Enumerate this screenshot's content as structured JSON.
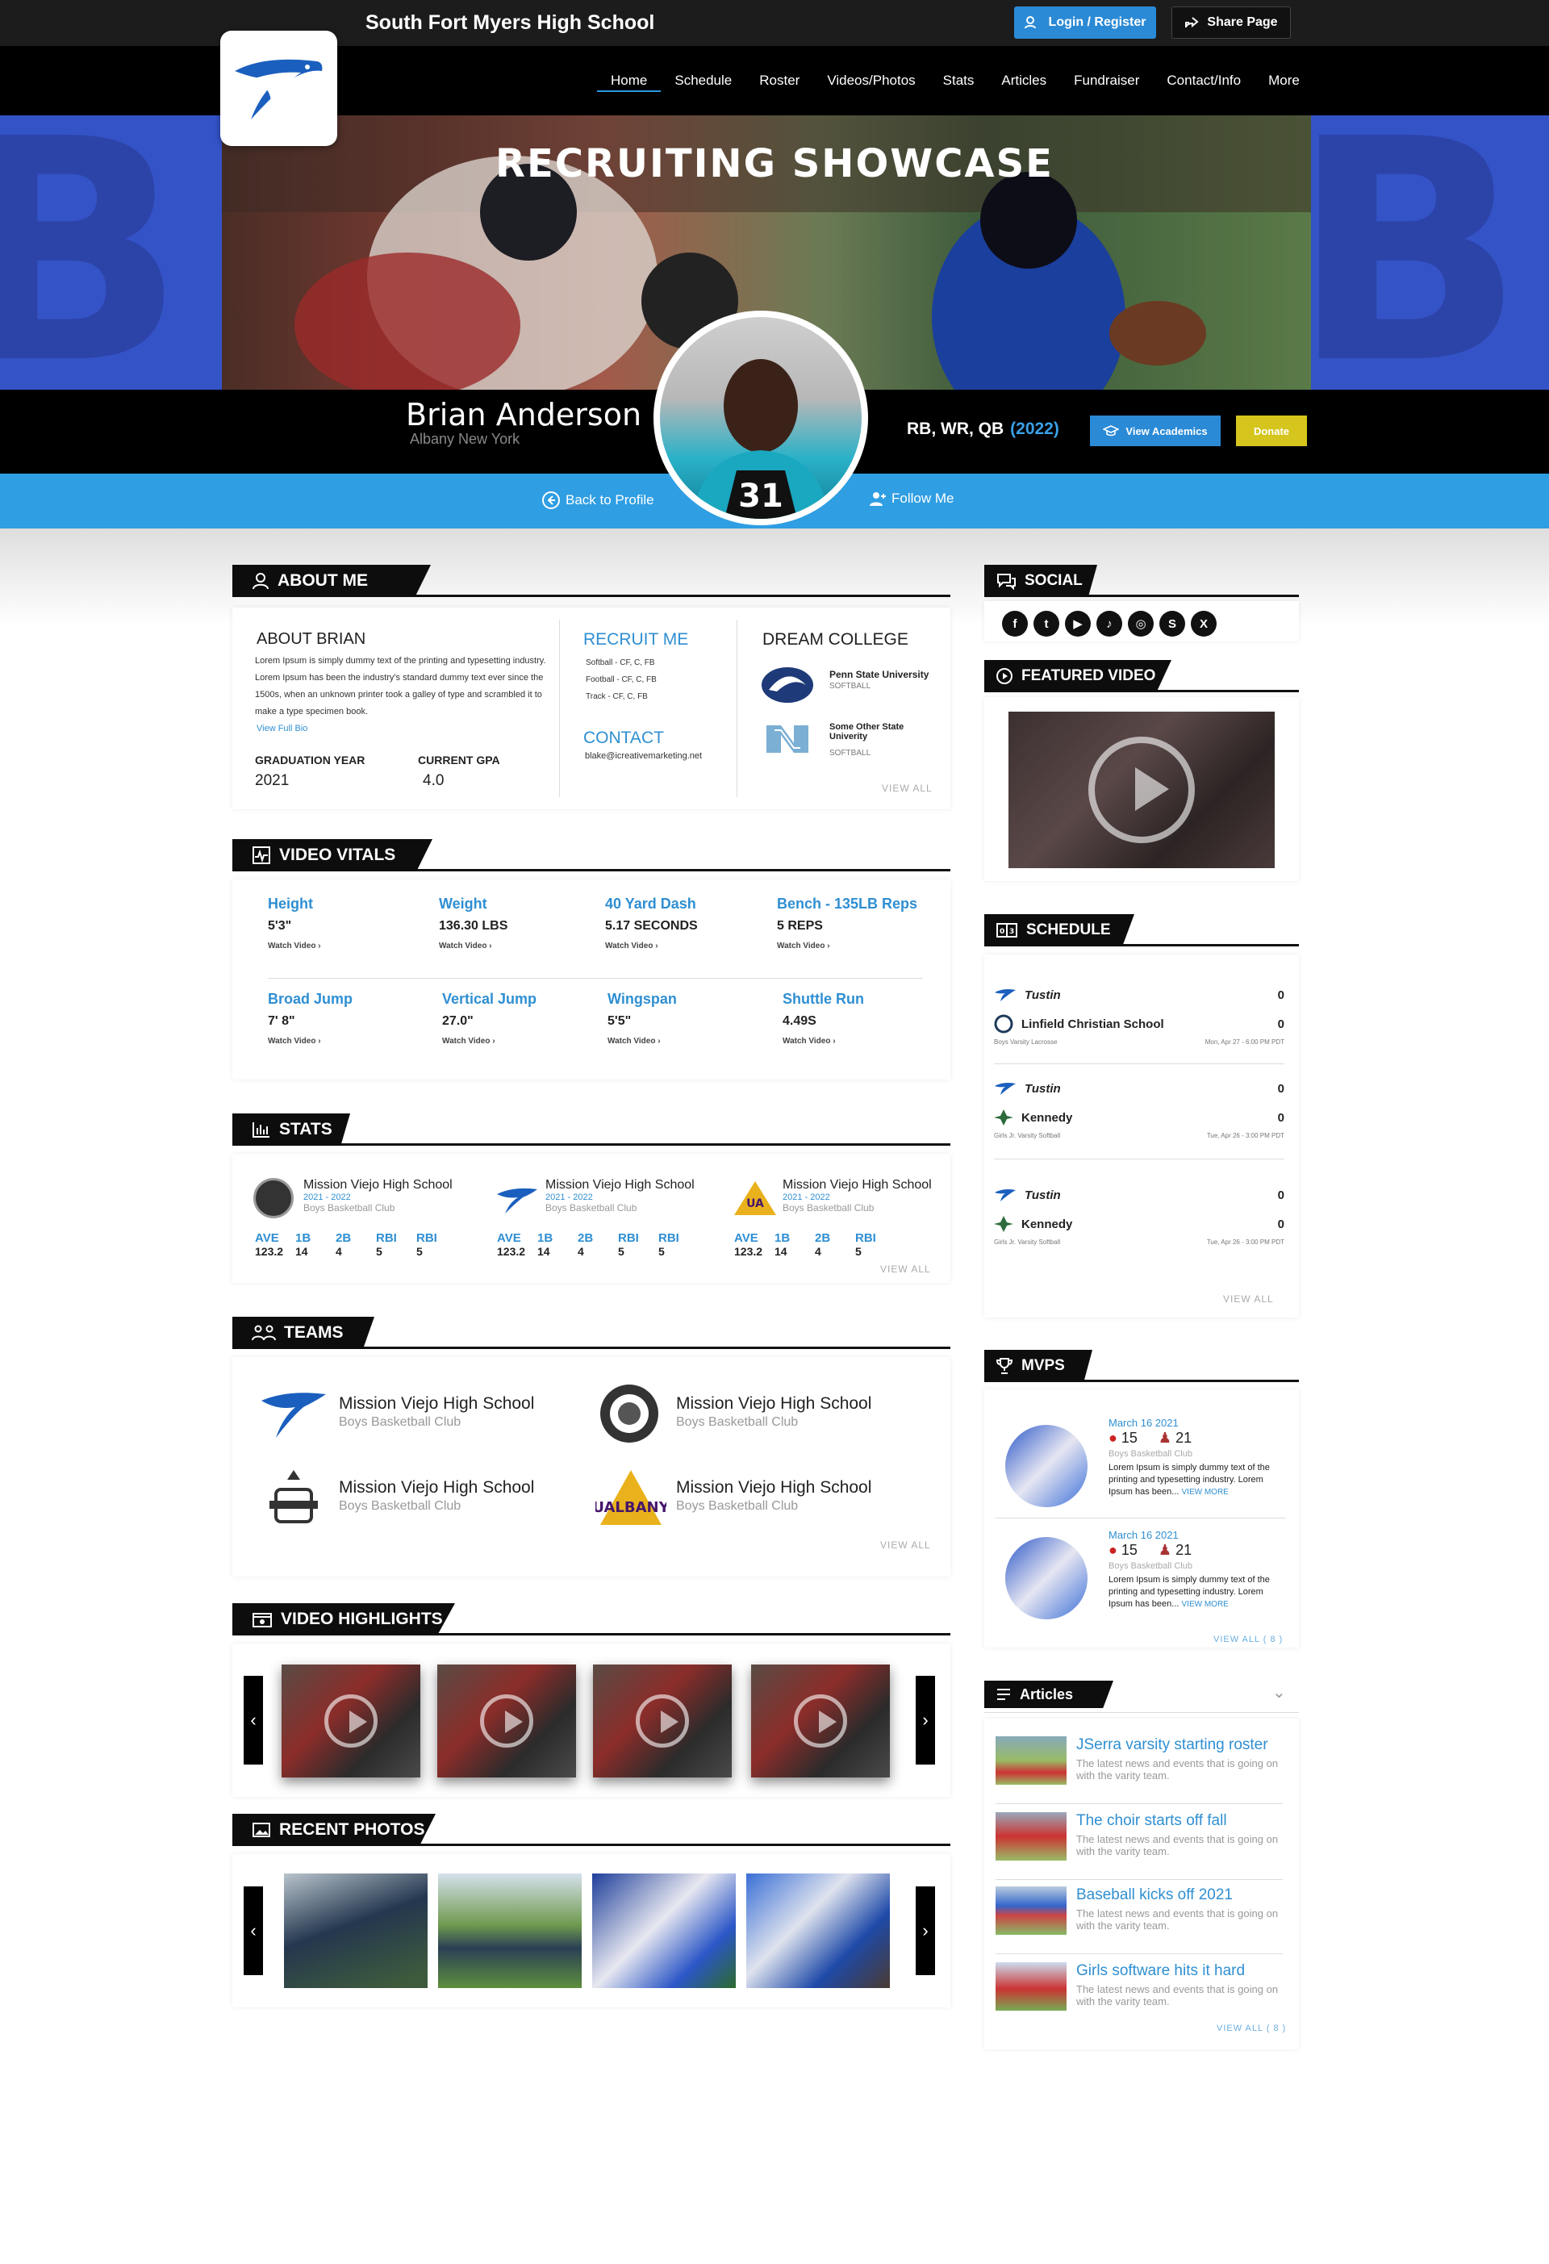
{
  "header": {
    "school_name": "South Fort Myers High School",
    "login_label": "Login / Register",
    "share_label": "Share Page"
  },
  "nav": [
    "Home",
    "Schedule",
    "Roster",
    "Videos/Photos",
    "Stats",
    "Articles",
    "Fundraiser",
    "Contact/Info",
    "More"
  ],
  "hero": {
    "title": "RECRUITING SHOWCASE"
  },
  "player": {
    "name": "Brian Anderson",
    "location": "Albany New York",
    "positions": "RB, WR, QB",
    "year": "(2022)",
    "academics_label": "View Academics",
    "donate_label": "Donate",
    "back_label": "Back to Profile",
    "follow_label": "Follow Me"
  },
  "about": {
    "tab": "ABOUT ME",
    "heading": "ABOUT BRIAN",
    "bio": "Lorem Ipsum is simply dummy text of the printing and typesetting industry. Lorem Ipsum has been the industry's standard dummy text ever since the 1500s, when an unknown printer took a galley of type and scrambled it to make a type specimen book.",
    "view_bio": "View Full Bio",
    "grad_label": "GRADUATION YEAR",
    "grad_value": "2021",
    "gpa_label": "CURRENT GPA",
    "gpa_value": "4.0",
    "recruit_heading": "RECRUIT ME",
    "recruit_lines": [
      "Softball - CF, C, FB",
      "Football - CF, C, FB",
      "Track - CF, C, FB"
    ],
    "contact_heading": "CONTACT",
    "contact_email": "blake@icreativemarketing.net",
    "dream_heading": "DREAM COLLEGE",
    "colleges": [
      {
        "name": "Penn State University",
        "sport": "SOFTBALL"
      },
      {
        "name": "Some Other State Univerity",
        "sport": "SOFTBALL"
      }
    ],
    "view_all": "VIEW ALL"
  },
  "vitals": {
    "tab": "VIDEO VITALS",
    "items": [
      {
        "title": "Height",
        "value": "5'3\"",
        "link": "Watch Video"
      },
      {
        "title": "Weight",
        "value": "136.30 LBS",
        "link": "Watch Video"
      },
      {
        "title": "40 Yard Dash",
        "value": "5.17 SECONDS",
        "link": "Watch Video"
      },
      {
        "title": "Bench - 135LB Reps",
        "value": "5 REPS",
        "link": "Watch Video"
      },
      {
        "title": "Broad Jump",
        "value": "7' 8\"",
        "link": "Watch Video"
      },
      {
        "title": "Vertical Jump",
        "value": "27.0\"",
        "link": "Watch Video"
      },
      {
        "title": "Wingspan",
        "value": "5'5\"",
        "link": "Watch Video"
      },
      {
        "title": "Shuttle Run",
        "value": "4.49S",
        "link": "Watch Video"
      }
    ]
  },
  "stats": {
    "tab": "STATS",
    "cards": [
      {
        "name": "Mission Viejo High School",
        "year": "2021 - 2022",
        "club": "Boys Basketball Club",
        "cols": [
          [
            "AVE",
            "123.2"
          ],
          [
            "1B",
            "14"
          ],
          [
            "2B",
            "4"
          ],
          [
            "RBI",
            "5"
          ],
          [
            "RBI",
            "5"
          ]
        ]
      },
      {
        "name": "Mission Viejo High School",
        "year": "2021 - 2022",
        "club": "Boys Basketball Club",
        "cols": [
          [
            "AVE",
            "123.2"
          ],
          [
            "1B",
            "14"
          ],
          [
            "2B",
            "4"
          ],
          [
            "RBI",
            "5"
          ],
          [
            "RBI",
            "5"
          ]
        ]
      },
      {
        "name": "Mission Viejo High School",
        "year": "2021 - 2022",
        "club": "Boys Basketball Club",
        "cols": [
          [
            "AVE",
            "123.2"
          ],
          [
            "1B",
            "14"
          ],
          [
            "2B",
            "4"
          ],
          [
            "RBI",
            "5"
          ]
        ]
      }
    ],
    "view_all": "VIEW ALL"
  },
  "teams": {
    "tab": "TEAMS",
    "items": [
      {
        "name": "Mission Viejo High School",
        "club": "Boys Basketball Club"
      },
      {
        "name": "Mission Viejo High School",
        "club": "Boys Basketball Club"
      },
      {
        "name": "Mission Viejo High School",
        "club": "Boys Basketball Club"
      },
      {
        "name": "Mission Viejo High School",
        "club": "Boys Basketball Club"
      }
    ],
    "view_all": "VIEW ALL",
    "logo_text": "UALBANY"
  },
  "highlights": {
    "tab": "VIDEO HIGHLIGHTS"
  },
  "photos": {
    "tab": "RECENT PHOTOS"
  },
  "social": {
    "tab": "SOCIAL",
    "icons": [
      "facebook-icon",
      "twitter-icon",
      "youtube-icon",
      "tiktok-icon",
      "instagram-icon",
      "hudl-icon",
      "x-icon"
    ]
  },
  "featured": {
    "tab": "FEATURED VIDEO"
  },
  "schedule": {
    "tab": "SCHEDULE",
    "games": [
      {
        "home": "Tustin",
        "home_score": "0",
        "away": "Linfield Christian School",
        "away_score": "0",
        "league": "Boys Varsity Lacrosse",
        "date": "Mon, Apr 27 - 6:00 PM PDT"
      },
      {
        "home": "Tustin",
        "home_score": "0",
        "away": "Kennedy",
        "away_score": "0",
        "league": "Girls Jr. Varsity Softball",
        "date": "Tue, Apr 26 - 3:00 PM PDT"
      },
      {
        "home": "Tustin",
        "home_score": "0",
        "away": "Kennedy",
        "away_score": "0",
        "league": "Girls Jr. Varsity Softball",
        "date": "Tue, Apr 26 - 3:00 PM PDT"
      }
    ],
    "view_all": "VIEW ALL"
  },
  "mvps": {
    "tab": "MVPS",
    "items": [
      {
        "date": "March 16 2021",
        "stat1": "15",
        "stat2": "21",
        "club": "Boys Basketball Club",
        "desc": "Lorem Ipsum is simply dummy text of the printing and typesetting industry. Lorem Ipsum has been...",
        "more": "VIEW MORE"
      },
      {
        "date": "March 16 2021",
        "stat1": "15",
        "stat2": "21",
        "club": "Boys Basketball Club",
        "desc": "Lorem Ipsum is simply dummy text of the printing and typesetting industry. Lorem Ipsum has been...",
        "more": "VIEW MORE"
      }
    ],
    "view_all": "VIEW ALL ( 8 )"
  },
  "articles": {
    "tab": "Articles",
    "items": [
      {
        "title": "JSerra varsity starting roster",
        "desc": "The latest news and events that is going on with the varity team."
      },
      {
        "title": "The choir starts off fall",
        "desc": "The latest news and events that is going on with the varity team."
      },
      {
        "title": "Baseball kicks off 2021",
        "desc": "The latest news and events that is going on with the varity team."
      },
      {
        "title": "Girls software hits it hard",
        "desc": "The latest news and events that is going on with the varity team."
      }
    ],
    "view_all": "VIEW ALL ( 8 )"
  },
  "colors": {
    "accent": "#2f9ee3",
    "brand_blue": "#3453c7",
    "donate": "#d5c51c"
  }
}
